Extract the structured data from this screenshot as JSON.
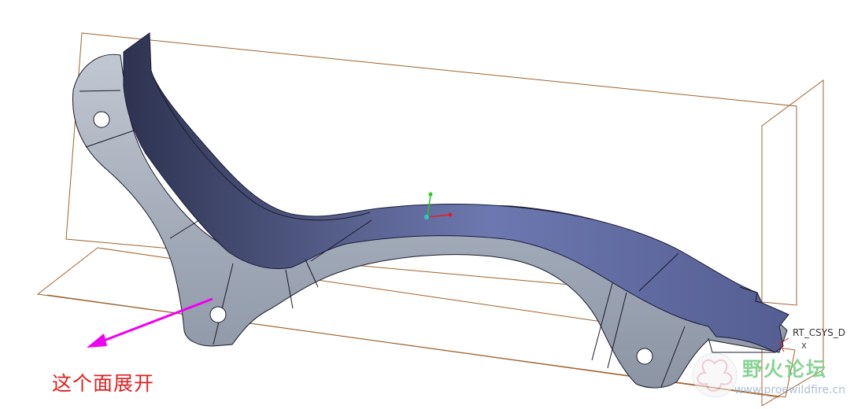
{
  "annotation": {
    "text": "这个面展开",
    "color": "#e02020",
    "arrow_color": "#f000f0"
  },
  "csys": {
    "label": "RT_CSYS_D",
    "axis_label": "X"
  },
  "watermark": {
    "brand": "野火论坛",
    "url": "www.proewildfire.cn"
  },
  "colors": {
    "datum_plane": "#a0622d",
    "part_side_face": "#a4adbb",
    "part_top_face": "#5c679a",
    "edge": "#1a1a2a",
    "background": "#ffffff"
  },
  "icons": {
    "origin": "coordinate-triad-icon",
    "watermark": "flower-logo-icon"
  }
}
